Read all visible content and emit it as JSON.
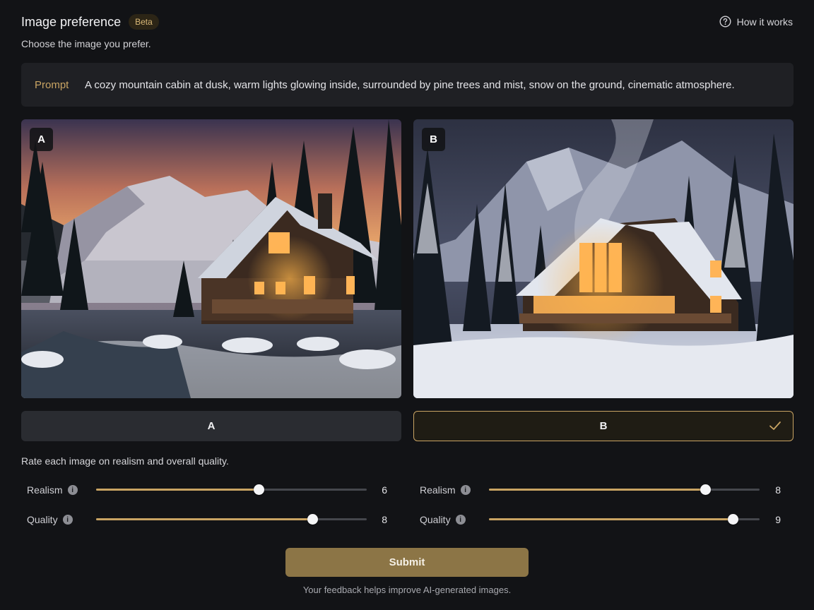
{
  "header": {
    "title": "Image preference",
    "badge": "Beta",
    "help_link": "How it works"
  },
  "subtitle": "Choose the image you prefer.",
  "prompt": {
    "label": "Prompt",
    "text": "A cozy mountain cabin at dusk, warm lights glowing inside, surrounded by pine trees and mist, snow on the ground, cinematic atmosphere."
  },
  "images": [
    {
      "badge": "A",
      "description_icon": "cabin-sunset-image"
    },
    {
      "badge": "B",
      "description_icon": "cabin-snow-night-image"
    }
  ],
  "choices": [
    {
      "label": "A",
      "selected": false
    },
    {
      "label": "B",
      "selected": true
    }
  ],
  "rating_note": "Rate each image on realism and overall quality.",
  "ratings": {
    "a": [
      {
        "label": "Realism",
        "value": 6,
        "display": "6"
      },
      {
        "label": "Quality",
        "value": 8,
        "display": "8"
      }
    ],
    "b": [
      {
        "label": "Realism",
        "value": 8,
        "display": "8"
      },
      {
        "label": "Quality",
        "value": 9,
        "display": "9"
      }
    ],
    "min": 0,
    "max": 10
  },
  "submit_label": "Submit",
  "footer": "Your feedback helps improve AI-generated images.",
  "colors": {
    "accent": "#c9a463",
    "background": "#121316",
    "panel": "#1f2024",
    "submit": "#8c7546"
  }
}
